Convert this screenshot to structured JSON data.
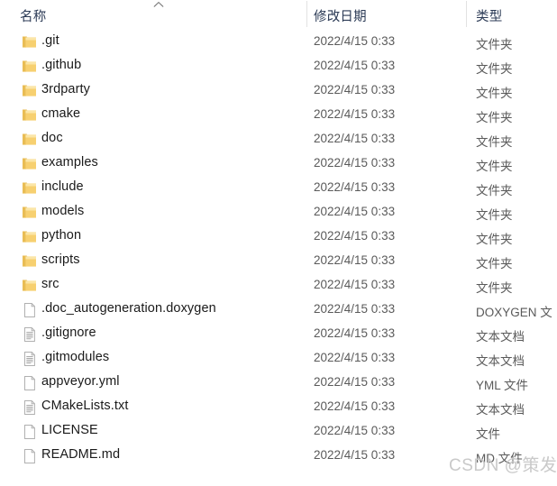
{
  "window": {
    "app": "file-explorer"
  },
  "header": {
    "columns": [
      {
        "label": "名称",
        "key": "name",
        "sorted": true,
        "sort_direction": "ascending"
      },
      {
        "label": "修改日期",
        "key": "date",
        "sorted": false
      },
      {
        "label": "类型",
        "key": "type",
        "sorted": false
      }
    ],
    "name_label": "名称",
    "date_label": "修改日期",
    "type_label": "类型",
    "sort_icon": "chevron-up-icon"
  },
  "colors": {
    "folder_fill": "#f7d070",
    "folder_fill_light": "#fbe6a8",
    "folder_tab": "#e9bd55",
    "file_fill": "#ffffff",
    "file_border": "#b0b0b0",
    "file_lines": "#9a9a9a",
    "header_text": "#2b3a55",
    "name_text": "#1a1a1a",
    "meta_text": "#5a5a5a",
    "divider": "#e2e2e2",
    "watermark": "#c9c9c9",
    "background": "#ffffff"
  },
  "rows": [
    {
      "icon": "folder-icon",
      "name": ".git",
      "date": "2022/4/15 0:33",
      "type": "文件夹"
    },
    {
      "icon": "folder-icon",
      "name": ".github",
      "date": "2022/4/15 0:33",
      "type": "文件夹"
    },
    {
      "icon": "folder-icon",
      "name": "3rdparty",
      "date": "2022/4/15 0:33",
      "type": "文件夹"
    },
    {
      "icon": "folder-icon",
      "name": "cmake",
      "date": "2022/4/15 0:33",
      "type": "文件夹"
    },
    {
      "icon": "folder-icon",
      "name": "doc",
      "date": "2022/4/15 0:33",
      "type": "文件夹"
    },
    {
      "icon": "folder-icon",
      "name": "examples",
      "date": "2022/4/15 0:33",
      "type": "文件夹"
    },
    {
      "icon": "folder-icon",
      "name": "include",
      "date": "2022/4/15 0:33",
      "type": "文件夹"
    },
    {
      "icon": "folder-icon",
      "name": "models",
      "date": "2022/4/15 0:33",
      "type": "文件夹"
    },
    {
      "icon": "folder-icon",
      "name": "python",
      "date": "2022/4/15 0:33",
      "type": "文件夹"
    },
    {
      "icon": "folder-icon",
      "name": "scripts",
      "date": "2022/4/15 0:33",
      "type": "文件夹"
    },
    {
      "icon": "folder-icon",
      "name": "src",
      "date": "2022/4/15 0:33",
      "type": "文件夹"
    },
    {
      "icon": "blank-file-icon",
      "name": ".doc_autogeneration.doxygen",
      "date": "2022/4/15 0:33",
      "type": "DOXYGEN 文"
    },
    {
      "icon": "text-file-icon",
      "name": ".gitignore",
      "date": "2022/4/15 0:33",
      "type": "文本文档"
    },
    {
      "icon": "text-file-icon",
      "name": ".gitmodules",
      "date": "2022/4/15 0:33",
      "type": "文本文档"
    },
    {
      "icon": "blank-file-icon",
      "name": "appveyor.yml",
      "date": "2022/4/15 0:33",
      "type": "YML 文件"
    },
    {
      "icon": "text-file-icon",
      "name": "CMakeLists.txt",
      "date": "2022/4/15 0:33",
      "type": "文本文档"
    },
    {
      "icon": "blank-file-icon",
      "name": "LICENSE",
      "date": "2022/4/15 0:33",
      "type": "文件"
    },
    {
      "icon": "blank-file-icon",
      "name": "README.md",
      "date": "2022/4/15 0:33",
      "type": "MD 文件"
    }
  ],
  "watermark": {
    "text": "CSDN @策发"
  }
}
